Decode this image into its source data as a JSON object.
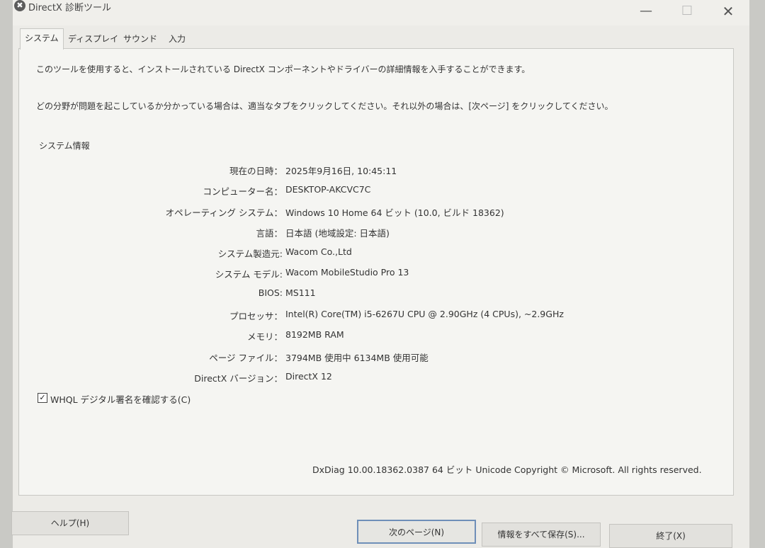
{
  "window": {
    "title": "DirectX 診断ツール",
    "app_icon_glyph": "✖",
    "minimize_glyph": "—",
    "maximize_glyph": "☐",
    "close_glyph": "✕"
  },
  "tabs": [
    {
      "label": "システム",
      "active": true
    },
    {
      "label": "ディスプレイ",
      "active": false
    },
    {
      "label": "サウンド",
      "active": false
    },
    {
      "label": "入力",
      "active": false
    }
  ],
  "intro": {
    "line1": "このツールを使用すると、インストールされている DirectX コンポーネントやドライバーの詳細情報を入手することができます。",
    "line2": "どの分野が問題を起こしているか分かっている場合は、適当なタブをクリックしてください。それ以外の場合は、[次ページ] をクリックしてください。"
  },
  "system_info": {
    "heading": "システム情報",
    "rows": [
      {
        "label": "現在の日時：",
        "value": "2025年9月16日, 10:45:11"
      },
      {
        "label": "コンピューター名：",
        "value": "DESKTOP-AKCVC7C"
      },
      {
        "label": "オペレーティング システム：",
        "value": "Windows 10 Home 64 ビット (10.0, ビルド 18362)"
      },
      {
        "label": "言語：",
        "value": "日本語 (地域設定: 日本語)"
      },
      {
        "label": "システム製造元:",
        "value": "Wacom Co.,Ltd"
      },
      {
        "label": "システム モデル:",
        "value": "Wacom MobileStudio Pro 13"
      },
      {
        "label": "BIOS:",
        "value": "MS111"
      },
      {
        "label": "プロセッサ：",
        "value": "Intel(R) Core(TM) i5-6267U CPU @ 2.90GHz (4 CPUs), ~2.9GHz"
      },
      {
        "label": "メモリ：",
        "value": "8192MB RAM"
      },
      {
        "label": "ページ ファイル：",
        "value": "3794MB 使用中 6134MB 使用可能"
      },
      {
        "label": "DirectX バージョン：",
        "value": "DirectX 12"
      }
    ]
  },
  "whql": {
    "label": "WHQL デジタル署名を確認する(C)",
    "checked": true,
    "check_glyph": "✓"
  },
  "footer": {
    "version_text": "DxDiag 10.00.18362.0387 64 ビット Unicode  Copyright © Microsoft. All rights reserved."
  },
  "buttons": {
    "help": "ヘルプ(H)",
    "next_page": "次のページ(N)",
    "save_all": "情報をすべて保存(S)...",
    "exit": "終了(X)"
  }
}
